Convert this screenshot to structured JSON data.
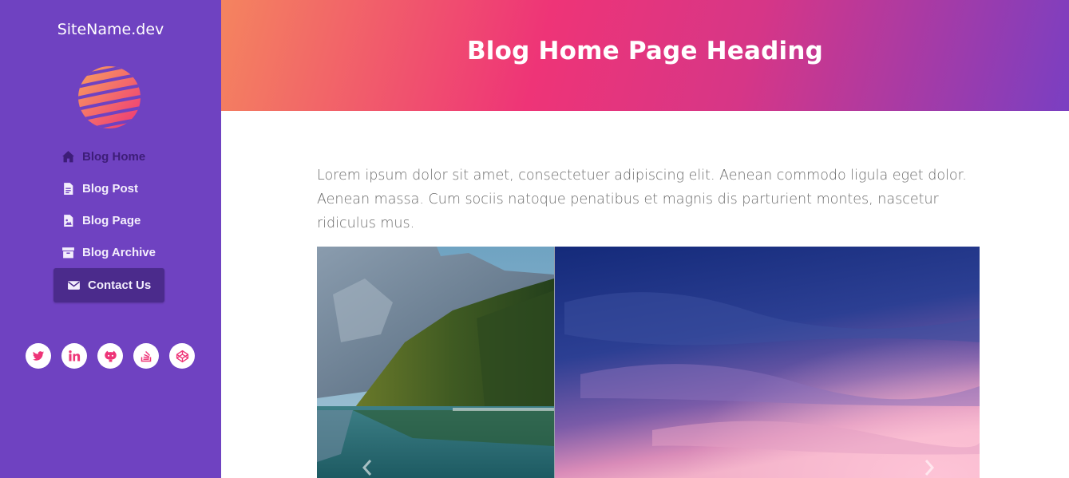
{
  "sidebar": {
    "site_name": "SiteName.dev",
    "logo_icon": "striped-globe-logo",
    "nav": [
      {
        "label": "Blog Home",
        "icon": "home-icon"
      },
      {
        "label": "Blog Post",
        "icon": "file-text-icon"
      },
      {
        "label": "Blog Page",
        "icon": "file-image-icon"
      },
      {
        "label": "Blog Archive",
        "icon": "archive-box-icon"
      },
      {
        "label": "Contact Us",
        "icon": "envelope-icon"
      }
    ],
    "social": [
      "twitter-icon",
      "linkedin-icon",
      "github-icon",
      "stackoverflow-icon",
      "codepen-icon"
    ]
  },
  "header": {
    "title": "Blog Home Page Heading"
  },
  "main": {
    "intro": "Lorem ipsum dolor sit amet, consectetuer adipiscing elit. Aenean commodo ligula eget dolor. Aenean massa. Cum sociis natoque penatibus et magnis dis parturient montes, nascetur ridiculus mus.",
    "carousel": {
      "slides": [
        "mountain-lake-photo",
        "sunset-sky-photo"
      ],
      "prev_icon": "chevron-left-icon",
      "next_icon": "chevron-right-icon"
    }
  },
  "colors": {
    "sidebar_bg": "#6f42c1",
    "accent_pink": "#ee3477",
    "accent_orange": "#f4845f",
    "contact_bg": "#4b2b8c"
  }
}
